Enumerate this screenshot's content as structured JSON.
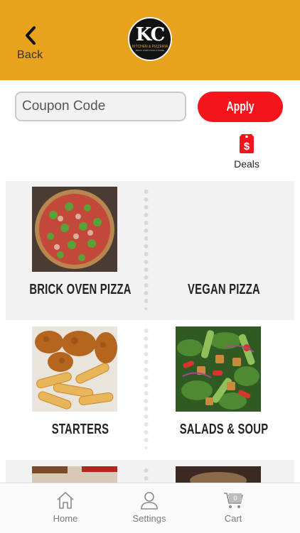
{
  "header": {
    "back_label": "Back",
    "logo_text": "KC",
    "logo_subtitle": "KITCHEN & PIZZERIA",
    "logo_tagline": "BRICK OVEN PIZZA & MORE"
  },
  "coupon": {
    "placeholder": "Coupon Code",
    "apply_label": "Apply"
  },
  "deals": {
    "label": "Deals"
  },
  "categories": [
    {
      "title": "BRICK OVEN PIZZA"
    },
    {
      "title": "VEGAN PIZZA"
    },
    {
      "title": "STARTERS"
    },
    {
      "title": "SALADS & SOUP"
    }
  ],
  "tabbar": {
    "items": [
      {
        "label": "Home"
      },
      {
        "label": "Settings"
      },
      {
        "label": "Cart",
        "badge": "0"
      }
    ]
  },
  "colors": {
    "header": "#e8a21c",
    "accent_red": "#f4141b",
    "band": "#f2f2f2"
  }
}
